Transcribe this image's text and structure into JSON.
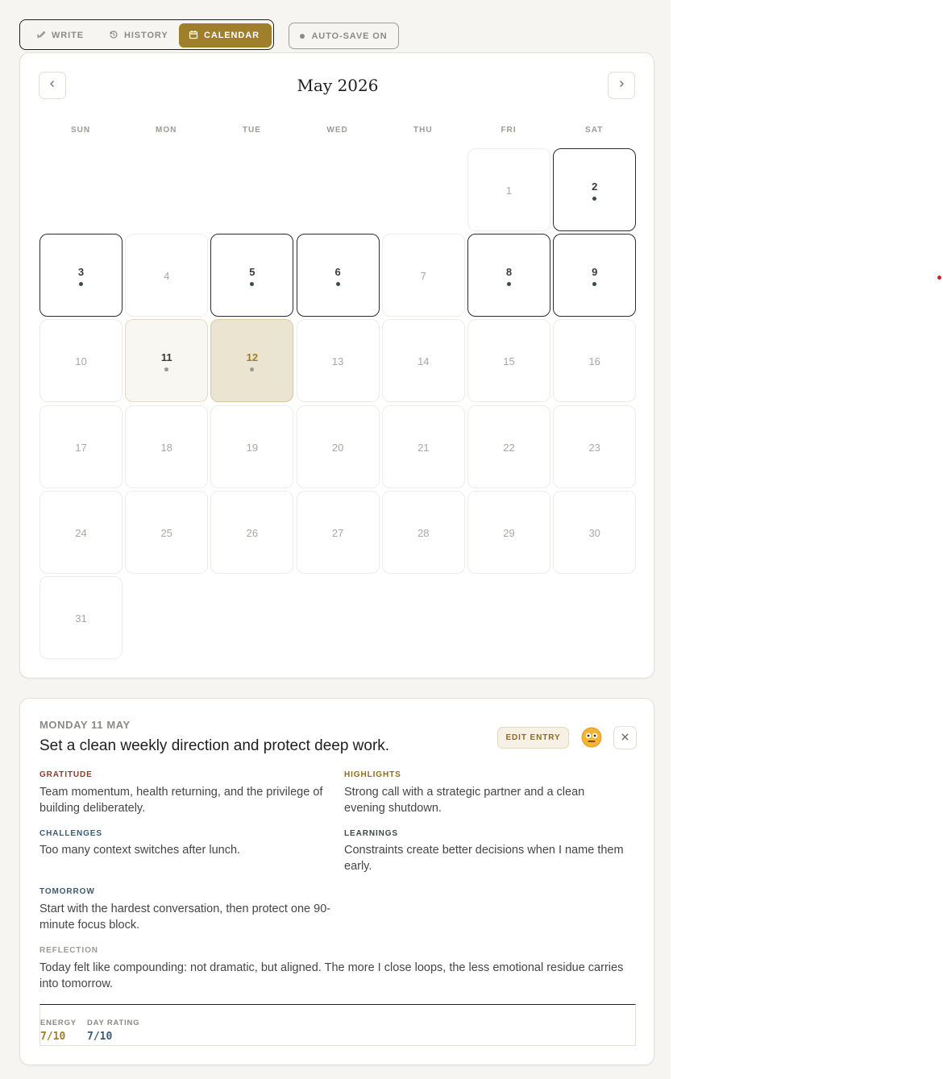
{
  "colors": {
    "accent": "#a07f2c",
    "gratitude": "#8a3a2e",
    "highlights": "#8a6c24",
    "challenges": "#3d5a72",
    "learnings": "#3b4a46",
    "tomorrow": "#3d5a72",
    "reflection": "#9b9a95",
    "energy": "#a07f2c",
    "day_rating": "#3d5a72"
  },
  "toolbar": {
    "tabs": [
      {
        "label": "WRITE",
        "icon": "feather-icon"
      },
      {
        "label": "HISTORY",
        "icon": "history-icon"
      },
      {
        "label": "CALENDAR",
        "icon": "calendar-icon",
        "active": true
      }
    ],
    "autosave_label": "AUTO-SAVE ON"
  },
  "calendar": {
    "month_label": "May 2026",
    "weekdays": [
      "SUN",
      "MON",
      "TUE",
      "WED",
      "THU",
      "FRI",
      "SAT"
    ],
    "first_weekday": 5,
    "days_in_month": 31,
    "entry_days": [
      2,
      3,
      5,
      6,
      8,
      9,
      11,
      12
    ],
    "today": 11,
    "selected": 12
  },
  "entry": {
    "date_label": "MONDAY 11 MAY",
    "title": "Set a clean weekly direction and protect deep work.",
    "edit_label": "EDIT ENTRY",
    "mood_icon": "neutral-face-icon",
    "sections": {
      "gratitude": {
        "label": "GRATITUDE",
        "text": "Team momentum, health returning, and the privilege of building deliberately."
      },
      "highlights": {
        "label": "HIGHLIGHTS",
        "text": "Strong call with a strategic partner and a clean evening shutdown."
      },
      "challenges": {
        "label": "CHALLENGES",
        "text": "Too many context switches after lunch."
      },
      "learnings": {
        "label": "LEARNINGS",
        "text": "Constraints create better decisions when I name them early."
      },
      "tomorrow": {
        "label": "TOMORROW",
        "text": "Start with the hardest conversation, then protect one 90-minute focus block."
      },
      "reflection": {
        "label": "REFLECTION",
        "text": "Today felt like compounding: not dramatic, but aligned. The more I close loops, the less emotional residue carries into tomorrow."
      }
    },
    "stats": {
      "energy_label": "ENERGY",
      "energy_value": "7/10",
      "rating_label": "DAY RATING",
      "rating_value": "7/10"
    }
  }
}
